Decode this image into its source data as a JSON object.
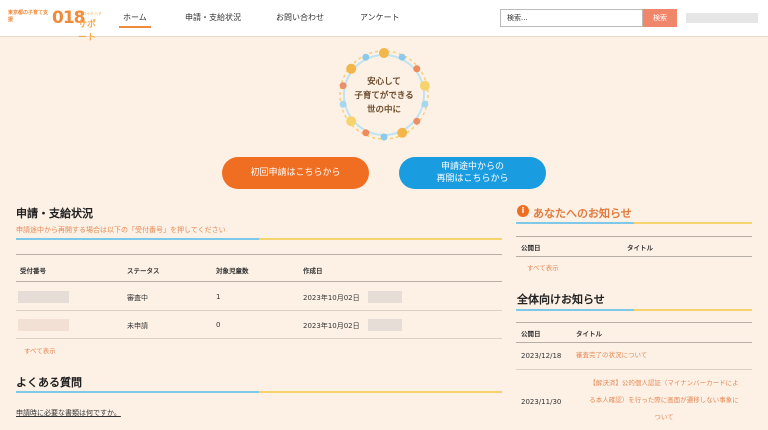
{
  "header": {
    "logo_small": "東京都の子育て支援",
    "logo_number": "018",
    "logo_sub": "ゼロイチハチ",
    "logo_kana": "サポート",
    "nav": [
      "ホーム",
      "申請・支給状況",
      "お問い合わせ",
      "アンケート"
    ],
    "search_placeholder": "検索...",
    "search_button": "検索"
  },
  "hero": {
    "line1": "安心して",
    "line2": "子育てができる",
    "line3": "世の中に"
  },
  "actions": {
    "first_apply": "初回申請はこちらから",
    "resume_line1": "申請途中からの",
    "resume_line2": "再開はこちらから"
  },
  "status": {
    "title": "申請・支給状況",
    "note": "申請途中から再開する場合は以下の「受付番号」を押してください",
    "columns": [
      "受付番号",
      "ステータス",
      "対象児童数",
      "作成日"
    ],
    "rows": [
      {
        "status": "審査中",
        "children": "1",
        "created": "2023年10月02日"
      },
      {
        "status": "未申請",
        "children": "0",
        "created": "2023年10月02日"
      }
    ],
    "show_all": "すべて表示"
  },
  "faq": {
    "title": "よくある質問",
    "first_question": "申請時に必要な書類は何ですか。"
  },
  "personal_news": {
    "icon": "i",
    "title": "あなたへのお知らせ",
    "columns": [
      "公開日",
      "タイトル"
    ],
    "show_all": "すべて表示"
  },
  "public_news": {
    "title": "全体向けお知らせ",
    "columns": [
      "公開日",
      "タイトル"
    ],
    "items": [
      {
        "date": "2023/12/18",
        "title_lines": [
          "審査完了の状況について"
        ]
      },
      {
        "date": "2023/11/30",
        "title_lines": [
          "【解決済】公的個人認証（マイナンバーカードによ",
          "る本人確認）を行った際に画面が遷移しない事象に",
          "ついて"
        ]
      }
    ]
  },
  "colors": {
    "accent_orange": "#f06e22",
    "accent_blue": "#1a9ce0",
    "link": "#e48a56",
    "background": "#fdf1e6"
  }
}
